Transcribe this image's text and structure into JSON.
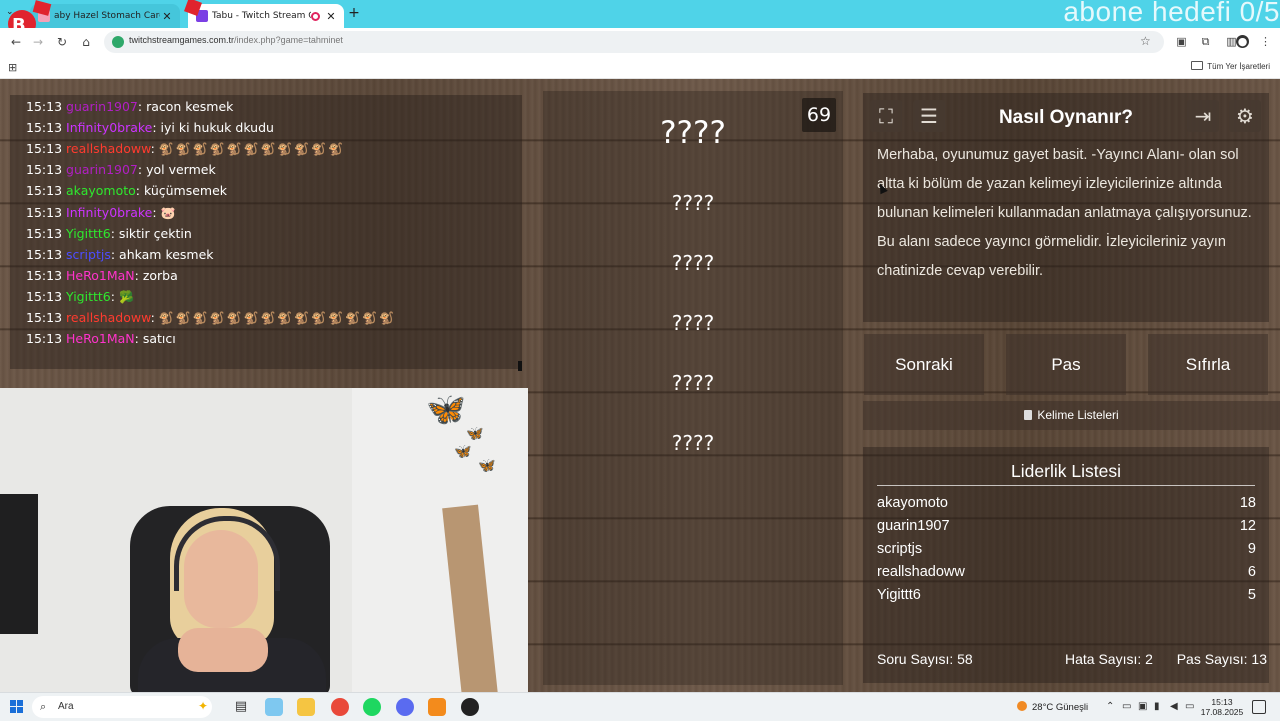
{
  "browser": {
    "tabs": [
      {
        "title": "aby Hazel Stomach Care - Oyu",
        "close": "✕"
      },
      {
        "title": "Tabu - Twitch Stream Game",
        "close": "✕"
      }
    ],
    "new_tab": "+",
    "url_host": "twitchstreamgames.com.tr",
    "url_path": "/index.php?game=tahminet",
    "bookmarks_all": "Tüm Yer İşaretleri"
  },
  "overlay": {
    "goal_text": "abone hedefi 0/5"
  },
  "chat": {
    "lines": [
      {
        "time": "15:13",
        "user": "guarin1907",
        "color": "#b11fc4",
        "message": ": racon kesmek"
      },
      {
        "time": "15:13",
        "user": "Infinity0brake",
        "color": "#cc33ff",
        "message": ": iyi ki hukuk dkudu"
      },
      {
        "time": "15:13",
        "user": "reallshadoww",
        "color": "#ff3b2f",
        "message": ":",
        "emotes": "🐒🐒🐒🐒🐒🐒🐒🐒🐒🐒🐒"
      },
      {
        "time": "15:13",
        "user": "guarin1907",
        "color": "#b11fc4",
        "message": ": yol vermek"
      },
      {
        "time": "15:13",
        "user": "akayomoto",
        "color": "#2ee82e",
        "message": ": küçümsemek"
      },
      {
        "time": "15:13",
        "user": "Infinity0brake",
        "color": "#cc33ff",
        "message": ":",
        "emotes": "🐷"
      },
      {
        "time": "15:13",
        "user": "Yigittt6",
        "color": "#2ee82e",
        "message": ": siktir çektin"
      },
      {
        "time": "15:13",
        "user": "scriptjs",
        "color": "#4d4dff",
        "message": ": ahkam kesmek"
      },
      {
        "time": "15:13",
        "user": "HeRo1MaN",
        "color": "#ff33cc",
        "message": ": zorba"
      },
      {
        "time": "15:13",
        "user": "Yigittt6",
        "color": "#2ee82e",
        "message": ":",
        "emotes": "🥦"
      },
      {
        "time": "15:13",
        "user": "reallshadoww",
        "color": "#ff3b2f",
        "message": ":",
        "emotes": "🐒🐒🐒🐒🐒🐒🐒🐒🐒🐒🐒🐒🐒🐒"
      },
      {
        "time": "15:13",
        "user": "HeRo1MaN",
        "color": "#ff33cc",
        "message": ": satıcı"
      }
    ]
  },
  "game": {
    "timer": "69",
    "main_word": "????",
    "taboo_words": [
      "????",
      "????",
      "????",
      "????",
      "????"
    ]
  },
  "info": {
    "title": "Nasıl Oynanır?",
    "description": "Merhaba, oyunumuz gayet basit. -Yayıncı Alanı- olan sol altta ki bölüm de yazan kelimeyi izleyicilerinize altında bulunan kelimeleri kullanmadan anlatmaya çalışıyorsunuz. Bu alanı sadece yayıncı görmelidir. İzleyicileriniz yayın chatinizde cevap verebilir."
  },
  "buttons": {
    "next": "Sonraki",
    "pass": "Pas",
    "reset": "Sıfırla",
    "word_lists": "Kelime Listeleri"
  },
  "leaderboard": {
    "title": "Liderlik Listesi",
    "rows": [
      {
        "name": "akayomoto",
        "score": "18"
      },
      {
        "name": "guarin1907",
        "score": "12"
      },
      {
        "name": "scriptjs",
        "score": "9"
      },
      {
        "name": "reallshadoww",
        "score": "6"
      },
      {
        "name": "Yigittt6",
        "score": "5"
      }
    ],
    "question_count": "Soru Sayısı: 58",
    "error_count": "Hata Sayısı: 2",
    "pass_count": "Pas Sayısı: 13"
  },
  "taskbar": {
    "search_placeholder": "Ara",
    "weather": "28°C  Güneşli",
    "time": "15:13",
    "date": "17.08.2025"
  },
  "icons": {
    "fullscreen": "fullscreen-icon",
    "list": "list-icon",
    "exit": "exit-icon",
    "settings": "gear-icon"
  }
}
